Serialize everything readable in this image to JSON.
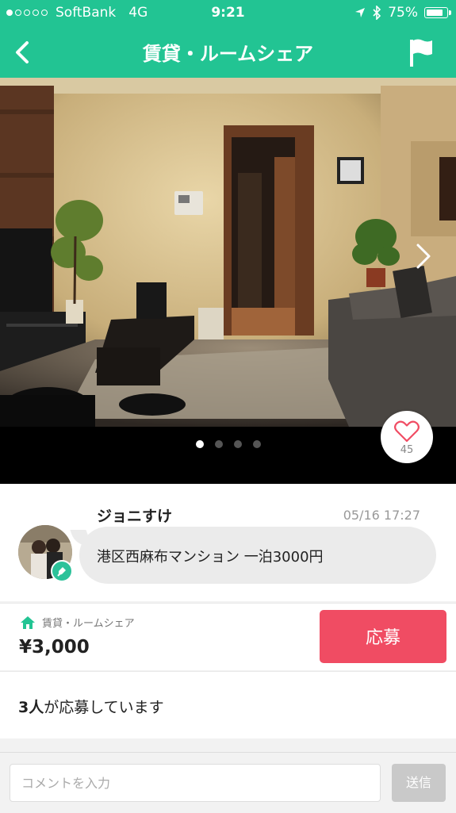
{
  "status_bar": {
    "carrier": "SoftBank",
    "network": "4G",
    "time": "9:21",
    "battery": "75%",
    "battery_level": 0.75
  },
  "header": {
    "title": "賃貸・ルームシェア",
    "back_icon": "chevron-left-icon",
    "flag_icon": "flag-icon"
  },
  "gallery": {
    "page_count": 4,
    "current_page": 1,
    "like_count": "45"
  },
  "post": {
    "username": "ジョニすけ",
    "timestamp": "05/16 17:27",
    "message": "港区西麻布マンション 一泊3000円"
  },
  "listing": {
    "category": "賃貸・ルームシェア",
    "price": "¥3,000",
    "apply_label": "応募"
  },
  "applicants": {
    "count": "3人",
    "suffix": "が応募しています"
  },
  "comment": {
    "placeholder": "コメントを入力",
    "send_label": "送信"
  },
  "colors": {
    "brand": "#22c493",
    "apply": "#f04c63",
    "like": "#f04c63"
  }
}
